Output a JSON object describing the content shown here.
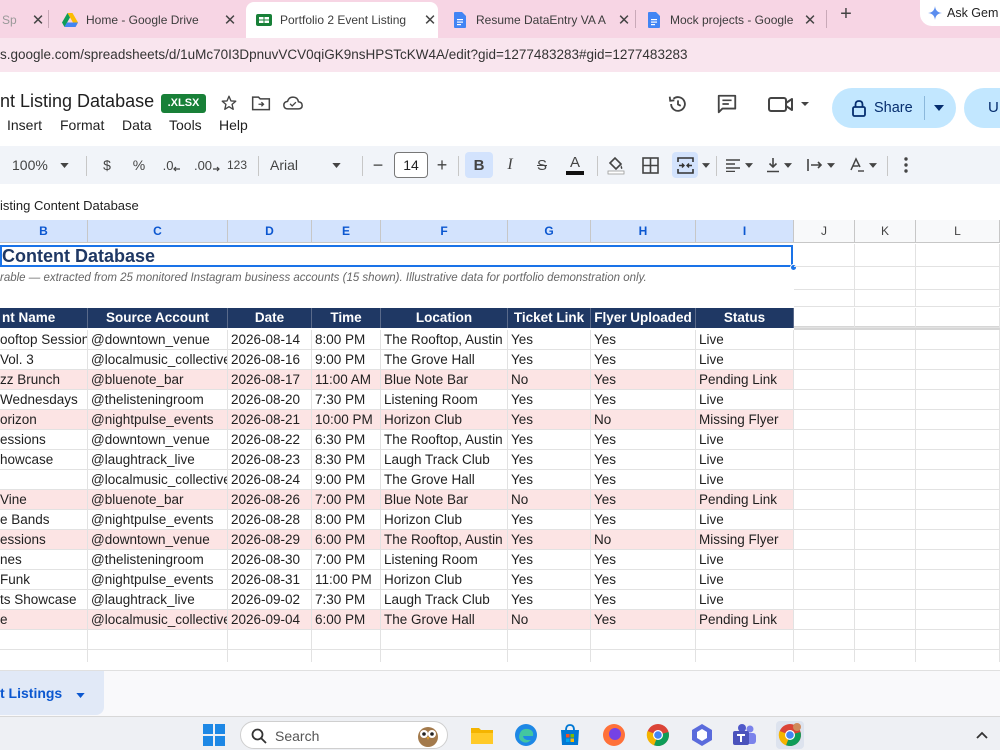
{
  "browser": {
    "tabs": [
      {
        "title": "Sp",
        "icon": "sheets-icon"
      },
      {
        "title": "Home - Google Drive",
        "icon": "drive-icon"
      },
      {
        "title": "Portfolio 2 Event Listing",
        "icon": "sheets-icon",
        "active": true
      },
      {
        "title": "Resume DataEntry VA A",
        "icon": "docs-icon"
      },
      {
        "title": "Mock projects - Google",
        "icon": "docs-icon"
      }
    ],
    "new_tab_label": "+",
    "ask_gemini_label": "Ask Gem",
    "url": "s.google.com/spreadsheets/d/1uMc70I3DpnuvVCV0qiGK9nsHPSTcKW4A/edit?gid=1277483283#gid=1277483283"
  },
  "sheets": {
    "doc_title": "nt Listing Database",
    "badge": ".XLSX",
    "share_label": "Share",
    "user_initial": "U",
    "menu": [
      "Insert",
      "Format",
      "Data",
      "Tools",
      "Help"
    ],
    "toolbar": {
      "zoom": "100%",
      "currency": "$",
      "percent": "%",
      "dec_decrease": ".0",
      "dec_increase": ".00",
      "number_format": "123",
      "font": "Arial",
      "font_size": "14",
      "bold": "B",
      "italic": "I",
      "strike": "S",
      "text_color": "A"
    },
    "formula": "isting Content Database",
    "column_letters": [
      "B",
      "C",
      "D",
      "E",
      "F",
      "G",
      "H",
      "I",
      "J",
      "K",
      "L"
    ],
    "title_text": "Content Database",
    "subtitle_text": "rable — extracted from 25 monitored Instagram business accounts (15 shown). Illustrative data for portfolio demonstration only.",
    "table_headers": [
      "nt Name",
      "Source Account",
      "Date",
      "Time",
      "Location",
      "Ticket Link",
      "Flyer Uploaded",
      "Status"
    ],
    "rows": [
      [
        "ooftop Session",
        "@downtown_venue",
        "2026-08-14",
        "8:00 PM",
        "The Rooftop, Austin",
        "Yes",
        "Yes",
        "Live"
      ],
      [
        " Vol. 3",
        "@localmusic_collective",
        "2026-08-16",
        "9:00 PM",
        "The Grove Hall",
        "Yes",
        "Yes",
        "Live"
      ],
      [
        "zz Brunch",
        "@bluenote_bar",
        "2026-08-17",
        "11:00 AM",
        "Blue Note Bar",
        "No",
        "Yes",
        "Pending Link"
      ],
      [
        "Wednesdays",
        "@thelisteningroom",
        "2026-08-20",
        "7:30 PM",
        "Listening Room",
        "Yes",
        "Yes",
        "Live"
      ],
      [
        "orizon",
        "@nightpulse_events",
        "2026-08-21",
        "10:00 PM",
        "Horizon Club",
        "Yes",
        "No",
        "Missing Flyer"
      ],
      [
        "essions",
        "@downtown_venue",
        "2026-08-22",
        "6:30 PM",
        "The Rooftop, Austin",
        "Yes",
        "Yes",
        "Live"
      ],
      [
        "howcase",
        "@laughtrack_live",
        "2026-08-23",
        "8:30 PM",
        "Laugh Track Club",
        "Yes",
        "Yes",
        "Live"
      ],
      [
        "",
        "@localmusic_collective",
        "2026-08-24",
        "9:00 PM",
        "The Grove Hall",
        "Yes",
        "Yes",
        "Live"
      ],
      [
        "Vine",
        "@bluenote_bar",
        "2026-08-26",
        "7:00 PM",
        "Blue Note Bar",
        "No",
        "Yes",
        "Pending Link"
      ],
      [
        "e Bands",
        "@nightpulse_events",
        "2026-08-28",
        "8:00 PM",
        "Horizon Club",
        "Yes",
        "Yes",
        "Live"
      ],
      [
        "essions",
        "@downtown_venue",
        "2026-08-29",
        "6:00 PM",
        "The Rooftop, Austin",
        "Yes",
        "No",
        "Missing Flyer"
      ],
      [
        "nes",
        "@thelisteningroom",
        "2026-08-30",
        "7:00 PM",
        "Listening Room",
        "Yes",
        "Yes",
        "Live"
      ],
      [
        " Funk",
        "@nightpulse_events",
        "2026-08-31",
        "11:00 PM",
        "Horizon Club",
        "Yes",
        "Yes",
        "Live"
      ],
      [
        "ts Showcase",
        "@laughtrack_live",
        "2026-09-02",
        "7:30 PM",
        "Laugh Track Club",
        "Yes",
        "Yes",
        "Live"
      ],
      [
        "e",
        "@localmusic_collective",
        "2026-09-04",
        "6:00 PM",
        "The Grove Hall",
        "No",
        "Yes",
        "Pending Link"
      ]
    ],
    "sheet_tab": "t Listings"
  },
  "taskbar": {
    "search_label": "Search"
  },
  "colors": {
    "header_navy": "#1f3864",
    "flag_row_pink": "#fce4e4",
    "accent_blue": "#1a73e8",
    "share_blue": "#c2e7ff"
  }
}
